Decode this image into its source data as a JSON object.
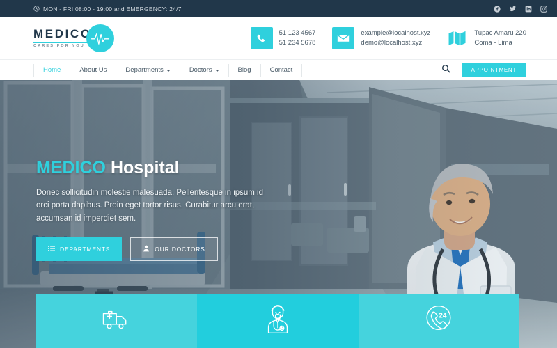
{
  "topbar": {
    "clock_icon": "clock-icon",
    "hours_text": "MON - FRI 08:00 - 19:00 and EMERGENCY: 24/7",
    "social": [
      {
        "name": "facebook-icon",
        "label": "Facebook"
      },
      {
        "name": "twitter-icon",
        "label": "Twitter"
      },
      {
        "name": "linkedin-icon",
        "label": "LinkedIn"
      },
      {
        "name": "instagram-icon",
        "label": "Instagram"
      }
    ],
    "bg_color": "#21374a"
  },
  "header": {
    "logo": {
      "name": "MEDICO",
      "tagline": "CARES FOR YOU",
      "mark_icon": "heartbeat-pulse-icon"
    },
    "contacts": [
      {
        "icon": "phone-icon",
        "line1": "51 123 4567",
        "line2": "51 234 5678"
      },
      {
        "icon": "envelope-icon",
        "line1": "example@localhost.xyz",
        "line2": "demo@localhost.xyz"
      },
      {
        "icon": "map-icon",
        "line1": "Tupac Amaru 220",
        "line2": "Coma - Lima"
      }
    ]
  },
  "nav": {
    "items": [
      {
        "label": "Home",
        "active": true,
        "dropdown": false
      },
      {
        "label": "About Us",
        "active": false,
        "dropdown": false
      },
      {
        "label": "Departments",
        "active": false,
        "dropdown": true
      },
      {
        "label": "Doctors",
        "active": false,
        "dropdown": true
      },
      {
        "label": "Blog",
        "active": false,
        "dropdown": false
      },
      {
        "label": "Contact",
        "active": false,
        "dropdown": false
      }
    ],
    "search_icon": "search-icon",
    "appointment_label": "APPOINTMENT",
    "accent_color": "#2fd0dd"
  },
  "hero": {
    "title_accent": "MEDICO",
    "title_rest": "Hospital",
    "description": "Donec sollicitudin molestie malesuada. Pellentesque in ipsum id orci porta dapibus. Proin eget tortor risus. Curabitur arcu erat, accumsan id imperdiet sem.",
    "buttons": [
      {
        "label": "DEPARTMENTS",
        "icon": "list-icon",
        "style": "primary"
      },
      {
        "label": "OUR DOCTORS",
        "icon": "user-icon",
        "style": "ghost"
      }
    ],
    "background_alt": "hospital-corridor-with-bed-and-doctor"
  },
  "features": [
    {
      "icon": "ambulance-icon",
      "color": "#45d3dd"
    },
    {
      "icon": "doctor-icon",
      "color": "#22cedd"
    },
    {
      "icon": "phone-24h-icon",
      "color": "#45d3dd"
    }
  ]
}
